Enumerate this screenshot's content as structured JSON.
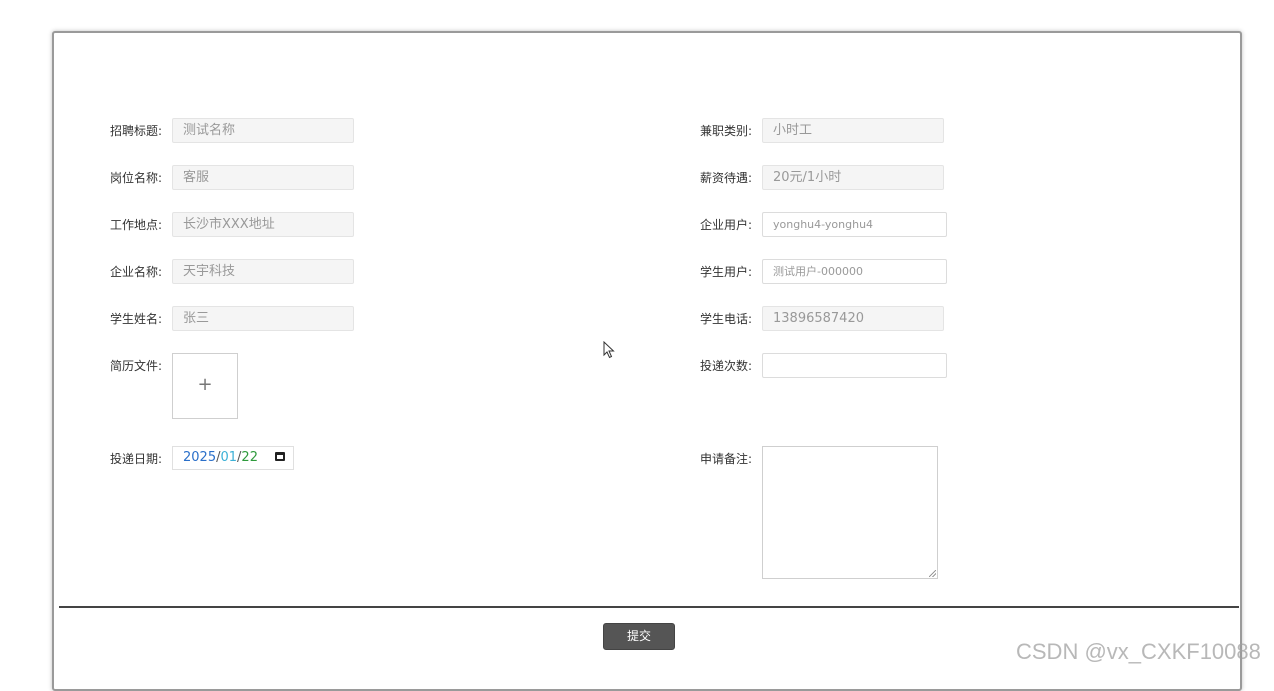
{
  "form": {
    "left": [
      {
        "label": "招聘标题:",
        "value": "测试名称"
      },
      {
        "label": "岗位名称:",
        "value": "客服"
      },
      {
        "label": "工作地点:",
        "value": "长沙市XXX地址"
      },
      {
        "label": "企业名称:",
        "value": "天宇科技"
      },
      {
        "label": "学生姓名:",
        "value": "张三"
      }
    ],
    "right": [
      {
        "label": "兼职类别:",
        "value": "小时工"
      },
      {
        "label": "薪资待遇:",
        "value": "20元/1小时"
      },
      {
        "label": "企业用户:",
        "value": "yonghu4-yonghu4"
      },
      {
        "label": "学生用户:",
        "value": "测试用户-000000"
      },
      {
        "label": "学生电话:",
        "value": "13896587420"
      }
    ],
    "resume": {
      "label": "简历文件:",
      "upload_symbol": "+"
    },
    "count": {
      "label": "投递次数:",
      "value": ""
    },
    "date": {
      "label": "投递日期:",
      "year": "2025",
      "month": "01",
      "day": "22",
      "sep": "/"
    },
    "remark": {
      "label": "申请备注:",
      "value": ""
    }
  },
  "actions": {
    "submit_label": "提交"
  },
  "watermark": "CSDN @vx_CXKF10088",
  "icons": {
    "calendar": "calendar-icon",
    "cursor": "mouse-cursor-icon"
  }
}
